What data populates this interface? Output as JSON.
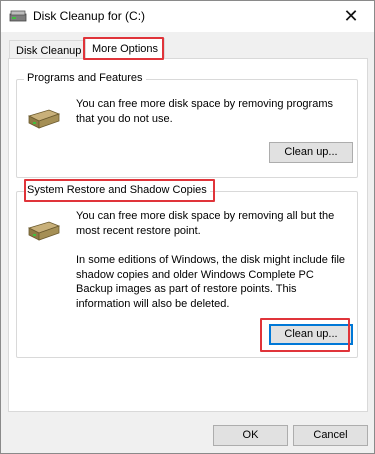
{
  "window": {
    "title": "Disk Cleanup for  (C:)"
  },
  "tabs": [
    {
      "label": "Disk Cleanup"
    },
    {
      "label": "More Options"
    }
  ],
  "groups": {
    "programs": {
      "label": "Programs and Features",
      "description": "You can free more disk space by removing programs that you do not use.",
      "button": "Clean up..."
    },
    "restore": {
      "label": "System Restore and Shadow Copies",
      "description": "You can free more disk space by removing all but the most recent restore point.",
      "note": "In some editions of Windows, the disk might include file shadow copies and older Windows Complete PC Backup images as part of restore points. This information will also be deleted.",
      "button": "Clean up..."
    }
  },
  "footer": {
    "ok": "OK",
    "cancel": "Cancel"
  },
  "colors": {
    "highlight": "#e0343a",
    "accent": "#0078d7"
  },
  "icons": {
    "title": "disk-drive-icon",
    "close": "close-icon",
    "group": "disk-drive-icon"
  }
}
